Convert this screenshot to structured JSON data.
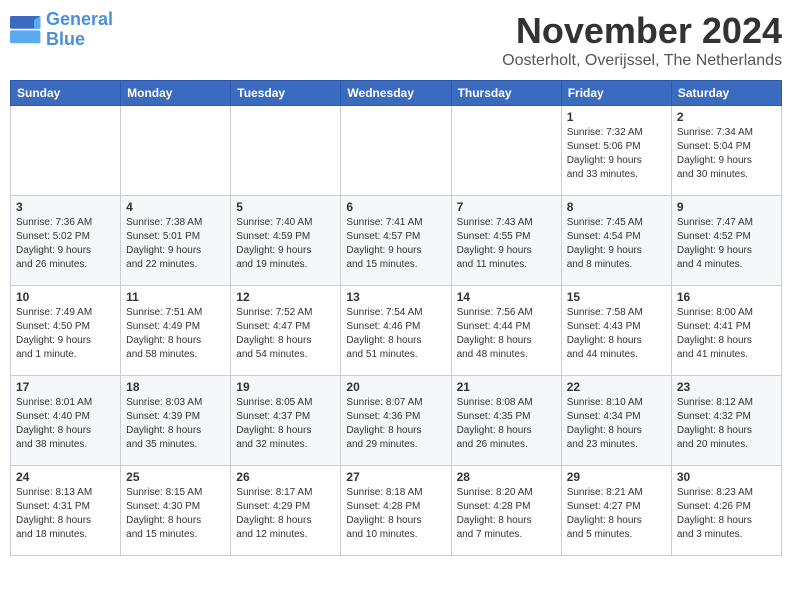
{
  "logo": {
    "line1": "General",
    "line2": "Blue"
  },
  "title": "November 2024",
  "location": "Oosterholt, Overijssel, The Netherlands",
  "weekdays": [
    "Sunday",
    "Monday",
    "Tuesday",
    "Wednesday",
    "Thursday",
    "Friday",
    "Saturday"
  ],
  "weeks": [
    [
      {
        "day": "",
        "info": ""
      },
      {
        "day": "",
        "info": ""
      },
      {
        "day": "",
        "info": ""
      },
      {
        "day": "",
        "info": ""
      },
      {
        "day": "",
        "info": ""
      },
      {
        "day": "1",
        "info": "Sunrise: 7:32 AM\nSunset: 5:06 PM\nDaylight: 9 hours\nand 33 minutes."
      },
      {
        "day": "2",
        "info": "Sunrise: 7:34 AM\nSunset: 5:04 PM\nDaylight: 9 hours\nand 30 minutes."
      }
    ],
    [
      {
        "day": "3",
        "info": "Sunrise: 7:36 AM\nSunset: 5:02 PM\nDaylight: 9 hours\nand 26 minutes."
      },
      {
        "day": "4",
        "info": "Sunrise: 7:38 AM\nSunset: 5:01 PM\nDaylight: 9 hours\nand 22 minutes."
      },
      {
        "day": "5",
        "info": "Sunrise: 7:40 AM\nSunset: 4:59 PM\nDaylight: 9 hours\nand 19 minutes."
      },
      {
        "day": "6",
        "info": "Sunrise: 7:41 AM\nSunset: 4:57 PM\nDaylight: 9 hours\nand 15 minutes."
      },
      {
        "day": "7",
        "info": "Sunrise: 7:43 AM\nSunset: 4:55 PM\nDaylight: 9 hours\nand 11 minutes."
      },
      {
        "day": "8",
        "info": "Sunrise: 7:45 AM\nSunset: 4:54 PM\nDaylight: 9 hours\nand 8 minutes."
      },
      {
        "day": "9",
        "info": "Sunrise: 7:47 AM\nSunset: 4:52 PM\nDaylight: 9 hours\nand 4 minutes."
      }
    ],
    [
      {
        "day": "10",
        "info": "Sunrise: 7:49 AM\nSunset: 4:50 PM\nDaylight: 9 hours\nand 1 minute."
      },
      {
        "day": "11",
        "info": "Sunrise: 7:51 AM\nSunset: 4:49 PM\nDaylight: 8 hours\nand 58 minutes."
      },
      {
        "day": "12",
        "info": "Sunrise: 7:52 AM\nSunset: 4:47 PM\nDaylight: 8 hours\nand 54 minutes."
      },
      {
        "day": "13",
        "info": "Sunrise: 7:54 AM\nSunset: 4:46 PM\nDaylight: 8 hours\nand 51 minutes."
      },
      {
        "day": "14",
        "info": "Sunrise: 7:56 AM\nSunset: 4:44 PM\nDaylight: 8 hours\nand 48 minutes."
      },
      {
        "day": "15",
        "info": "Sunrise: 7:58 AM\nSunset: 4:43 PM\nDaylight: 8 hours\nand 44 minutes."
      },
      {
        "day": "16",
        "info": "Sunrise: 8:00 AM\nSunset: 4:41 PM\nDaylight: 8 hours\nand 41 minutes."
      }
    ],
    [
      {
        "day": "17",
        "info": "Sunrise: 8:01 AM\nSunset: 4:40 PM\nDaylight: 8 hours\nand 38 minutes."
      },
      {
        "day": "18",
        "info": "Sunrise: 8:03 AM\nSunset: 4:39 PM\nDaylight: 8 hours\nand 35 minutes."
      },
      {
        "day": "19",
        "info": "Sunrise: 8:05 AM\nSunset: 4:37 PM\nDaylight: 8 hours\nand 32 minutes."
      },
      {
        "day": "20",
        "info": "Sunrise: 8:07 AM\nSunset: 4:36 PM\nDaylight: 8 hours\nand 29 minutes."
      },
      {
        "day": "21",
        "info": "Sunrise: 8:08 AM\nSunset: 4:35 PM\nDaylight: 8 hours\nand 26 minutes."
      },
      {
        "day": "22",
        "info": "Sunrise: 8:10 AM\nSunset: 4:34 PM\nDaylight: 8 hours\nand 23 minutes."
      },
      {
        "day": "23",
        "info": "Sunrise: 8:12 AM\nSunset: 4:32 PM\nDaylight: 8 hours\nand 20 minutes."
      }
    ],
    [
      {
        "day": "24",
        "info": "Sunrise: 8:13 AM\nSunset: 4:31 PM\nDaylight: 8 hours\nand 18 minutes."
      },
      {
        "day": "25",
        "info": "Sunrise: 8:15 AM\nSunset: 4:30 PM\nDaylight: 8 hours\nand 15 minutes."
      },
      {
        "day": "26",
        "info": "Sunrise: 8:17 AM\nSunset: 4:29 PM\nDaylight: 8 hours\nand 12 minutes."
      },
      {
        "day": "27",
        "info": "Sunrise: 8:18 AM\nSunset: 4:28 PM\nDaylight: 8 hours\nand 10 minutes."
      },
      {
        "day": "28",
        "info": "Sunrise: 8:20 AM\nSunset: 4:28 PM\nDaylight: 8 hours\nand 7 minutes."
      },
      {
        "day": "29",
        "info": "Sunrise: 8:21 AM\nSunset: 4:27 PM\nDaylight: 8 hours\nand 5 minutes."
      },
      {
        "day": "30",
        "info": "Sunrise: 8:23 AM\nSunset: 4:26 PM\nDaylight: 8 hours\nand 3 minutes."
      }
    ]
  ]
}
